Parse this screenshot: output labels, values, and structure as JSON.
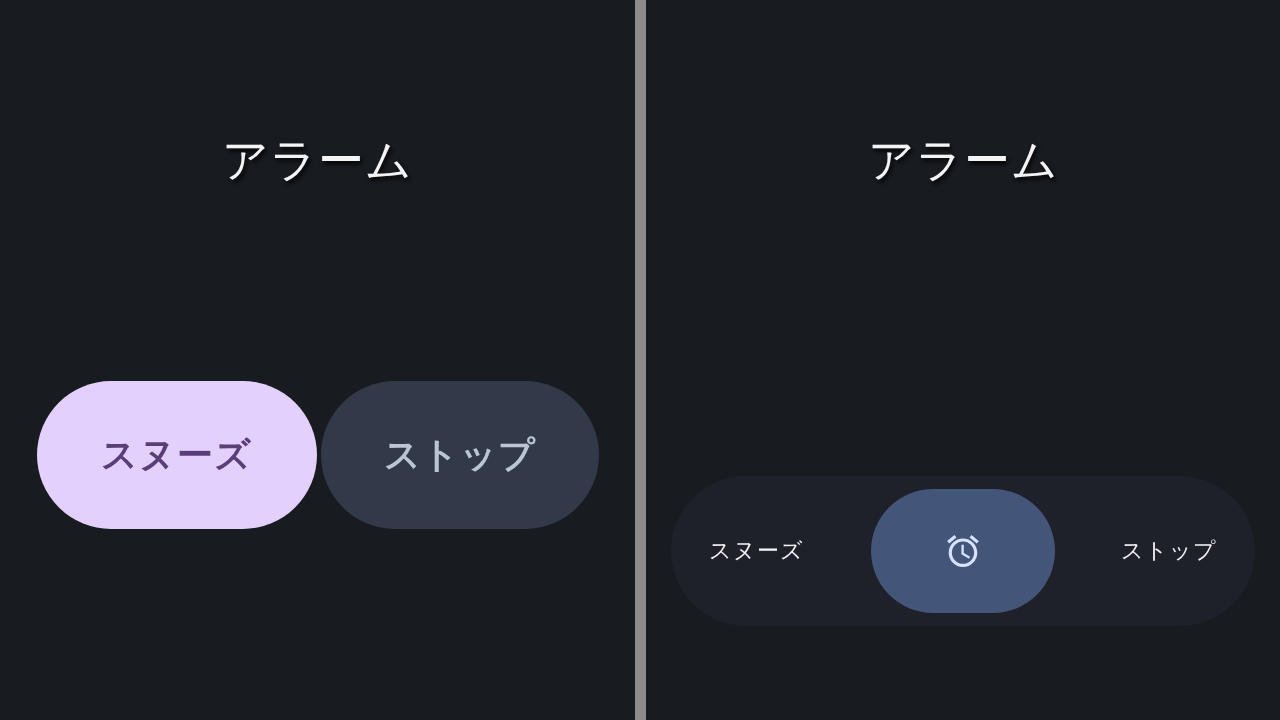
{
  "panels": [
    {
      "kind": "buttons",
      "title": "アラーム",
      "buttons": [
        {
          "label": "スヌーズ",
          "kind": "primary"
        },
        {
          "label": "ストップ",
          "kind": "secondary"
        }
      ]
    },
    {
      "kind": "slider",
      "title": "アラーム",
      "slider": {
        "left_label": "スヌーズ",
        "right_label": "ストップ",
        "level": 0.5
      }
    }
  ]
}
